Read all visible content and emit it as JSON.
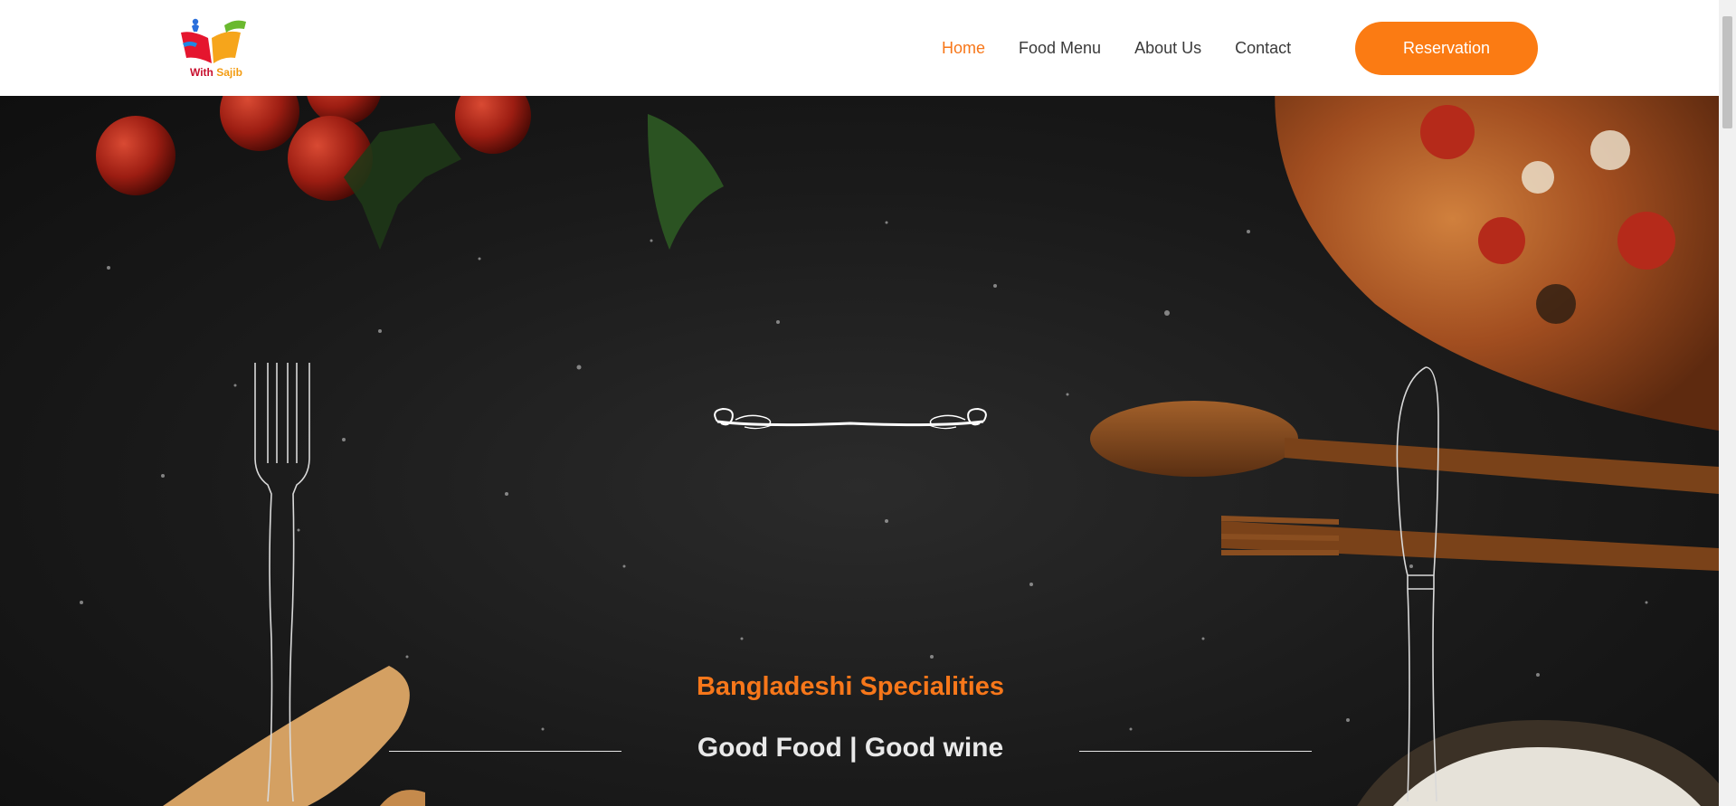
{
  "brand": {
    "logo_text_part1": "With",
    "logo_text_part2": "Sajib"
  },
  "nav": {
    "items": [
      {
        "label": "Home",
        "active": true
      },
      {
        "label": "Food Menu",
        "active": false
      },
      {
        "label": "About Us",
        "active": false
      },
      {
        "label": "Contact",
        "active": false
      }
    ],
    "cta_label": "Reservation"
  },
  "hero": {
    "subtitle": "Bangladeshi Specialities",
    "title": "Good Food | Good wine"
  },
  "colors": {
    "accent": "#fb7b13",
    "nav_text": "#3a3a3a",
    "hero_bg": "#1a1a1a"
  },
  "icons": {
    "ornament": "decorative-flourish-icon",
    "fork": "fork-outline-icon",
    "knife": "knife-outline-icon"
  }
}
